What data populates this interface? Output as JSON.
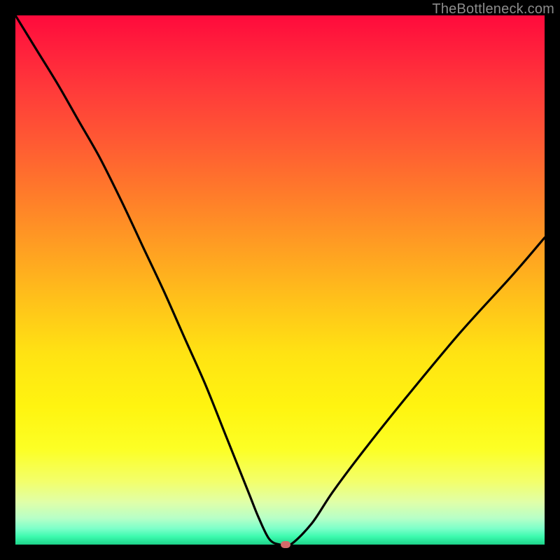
{
  "watermark": "TheBottleneck.com",
  "chart_data": {
    "type": "line",
    "title": "",
    "xlabel": "",
    "ylabel": "",
    "xlim": [
      0,
      100
    ],
    "ylim": [
      0,
      100
    ],
    "grid": false,
    "legend": false,
    "series": [
      {
        "name": "bottleneck-curve",
        "x": [
          0,
          4,
          8,
          12,
          16,
          20,
          24,
          28,
          32,
          36,
          40,
          44,
          46,
          48,
          50,
          52,
          56,
          60,
          66,
          74,
          84,
          94,
          100
        ],
        "y": [
          100,
          93.5,
          87,
          80,
          73,
          65,
          56.5,
          48,
          39,
          30,
          20,
          10,
          5,
          1,
          0,
          0,
          4,
          10,
          18,
          28,
          40,
          51,
          58
        ]
      }
    ],
    "marker": {
      "name": "optimal-point",
      "x": 51,
      "y": 0,
      "color": "#d46a6a"
    },
    "background_gradient": {
      "orientation": "vertical",
      "stops": [
        {
          "pos": 0.0,
          "color": "#ff0a3c"
        },
        {
          "pos": 0.24,
          "color": "#ff5a33"
        },
        {
          "pos": 0.54,
          "color": "#ffc21a"
        },
        {
          "pos": 0.82,
          "color": "#fcff25"
        },
        {
          "pos": 0.95,
          "color": "#b7ffc7"
        },
        {
          "pos": 1.0,
          "color": "#1dd38a"
        }
      ]
    }
  }
}
